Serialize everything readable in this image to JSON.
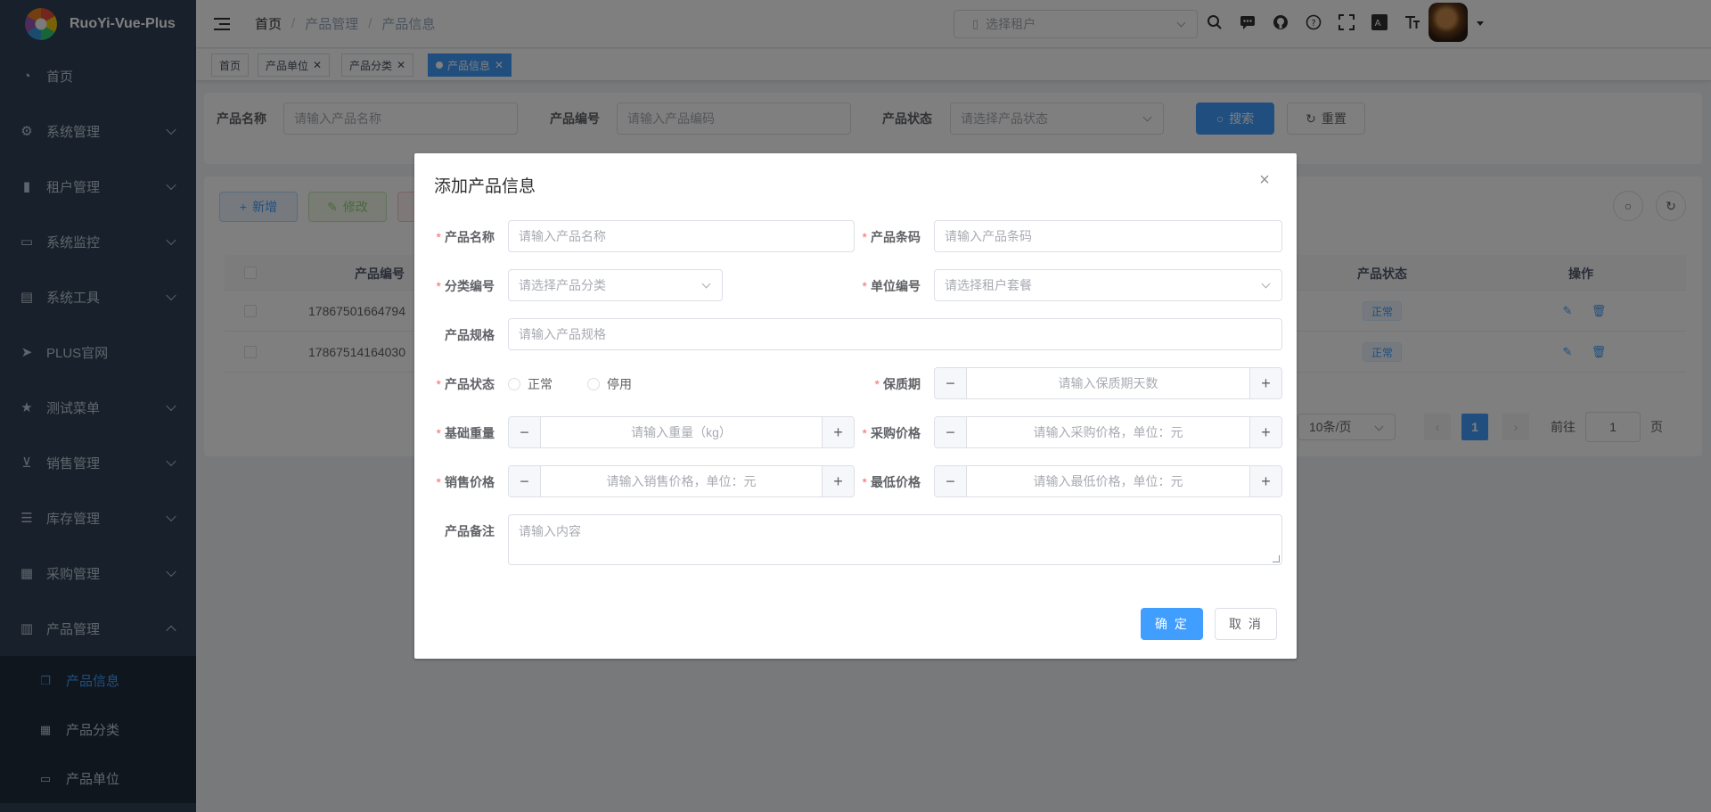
{
  "app": {
    "title": "RuoYi-Vue-Plus"
  },
  "sidebar": {
    "items": [
      {
        "label": "首页",
        "icon": "dashboard-icon",
        "glyph": "◔"
      },
      {
        "label": "系统管理",
        "icon": "gear-icon",
        "glyph": "⚙",
        "expandable": true
      },
      {
        "label": "租户管理",
        "icon": "chart-icon",
        "glyph": "▮",
        "expandable": true
      },
      {
        "label": "系统监控",
        "icon": "monitor-icon",
        "glyph": "▭",
        "expandable": true
      },
      {
        "label": "系统工具",
        "icon": "toolbox-icon",
        "glyph": "▤",
        "expandable": true
      },
      {
        "label": "PLUS官网",
        "icon": "send-icon",
        "glyph": "➤"
      },
      {
        "label": "测试菜单",
        "icon": "star-icon",
        "glyph": "★",
        "expandable": true
      },
      {
        "label": "销售管理",
        "icon": "cart-icon",
        "glyph": "⊻",
        "expandable": true
      },
      {
        "label": "库存管理",
        "icon": "list-icon",
        "glyph": "☰",
        "expandable": true
      },
      {
        "label": "采购管理",
        "icon": "grid-icon",
        "glyph": "▦",
        "expandable": true
      },
      {
        "label": "产品管理",
        "icon": "table-icon",
        "glyph": "▥",
        "expandable": true,
        "expanded": true
      }
    ],
    "subitems": [
      {
        "label": "产品信息",
        "icon": "document-icon",
        "glyph": "❐",
        "active": true
      },
      {
        "label": "产品分类",
        "icon": "table-icon",
        "glyph": "▦"
      },
      {
        "label": "产品单位",
        "icon": "unit-icon",
        "glyph": "▭"
      }
    ]
  },
  "navbar": {
    "breadcrumb": [
      "首页",
      "产品管理",
      "产品信息"
    ],
    "tenant_placeholder": "选择租户"
  },
  "tags": [
    {
      "label": "首页",
      "closable": false
    },
    {
      "label": "产品单位",
      "closable": true
    },
    {
      "label": "产品分类",
      "closable": true
    },
    {
      "label": "产品信息",
      "closable": true,
      "active": true
    }
  ],
  "search": {
    "name_label": "产品名称",
    "name_placeholder": "请输入产品名称",
    "code_label": "产品编号",
    "code_placeholder": "请输入产品编码",
    "status_label": "产品状态",
    "status_placeholder": "请选择产品状态",
    "search_button": "搜索",
    "reset_button": "重置"
  },
  "toolbar": {
    "add": "新增",
    "edit": "修改"
  },
  "table": {
    "columns": {
      "code": "产品编号",
      "status": "产品状态",
      "ops": "操作"
    },
    "rows": [
      {
        "code": "17867501664794",
        "status": "正常"
      },
      {
        "code": "17867514164030",
        "status": "正常"
      }
    ]
  },
  "pager": {
    "page_size": "10条/页",
    "current_page": "1",
    "goto_label": "前往",
    "goto_value": "1",
    "page_suffix": "页",
    "prev": "‹",
    "next": "›"
  },
  "dialog": {
    "title": "添加产品信息",
    "close": "×",
    "fields": {
      "name": {
        "label": "产品名称",
        "placeholder": "请输入产品名称",
        "required": true
      },
      "barcode": {
        "label": "产品条码",
        "placeholder": "请输入产品条码",
        "required": true
      },
      "category": {
        "label": "分类编号",
        "placeholder": "请选择产品分类",
        "required": true
      },
      "unit": {
        "label": "单位编号",
        "placeholder": "请选择租户套餐",
        "required": true
      },
      "spec": {
        "label": "产品规格",
        "placeholder": "请输入产品规格",
        "required": false
      },
      "status": {
        "label": "产品状态",
        "options": [
          "正常",
          "停用"
        ],
        "required": true
      },
      "shelf_life": {
        "label": "保质期",
        "placeholder": "请输入保质期天数",
        "required": true
      },
      "weight": {
        "label": "基础重量",
        "placeholder": "请输入重量（kg）",
        "required": true
      },
      "purchase_price": {
        "label": "采购价格",
        "placeholder": "请输入采购价格，单位：元",
        "required": true
      },
      "sale_price": {
        "label": "销售价格",
        "placeholder": "请输入销售价格，单位：元",
        "required": true
      },
      "min_price": {
        "label": "最低价格",
        "placeholder": "请输入最低价格，单位：元",
        "required": true
      },
      "remark": {
        "label": "产品备注",
        "placeholder": "请输入内容",
        "required": false
      }
    },
    "confirm": "确 定",
    "cancel": "取 消",
    "minus": "−",
    "plus": "+",
    "req_mark": "*"
  },
  "colors": {
    "primary": "#409eff",
    "sidebar_bg": "#304156",
    "required": "#f56c6c"
  }
}
